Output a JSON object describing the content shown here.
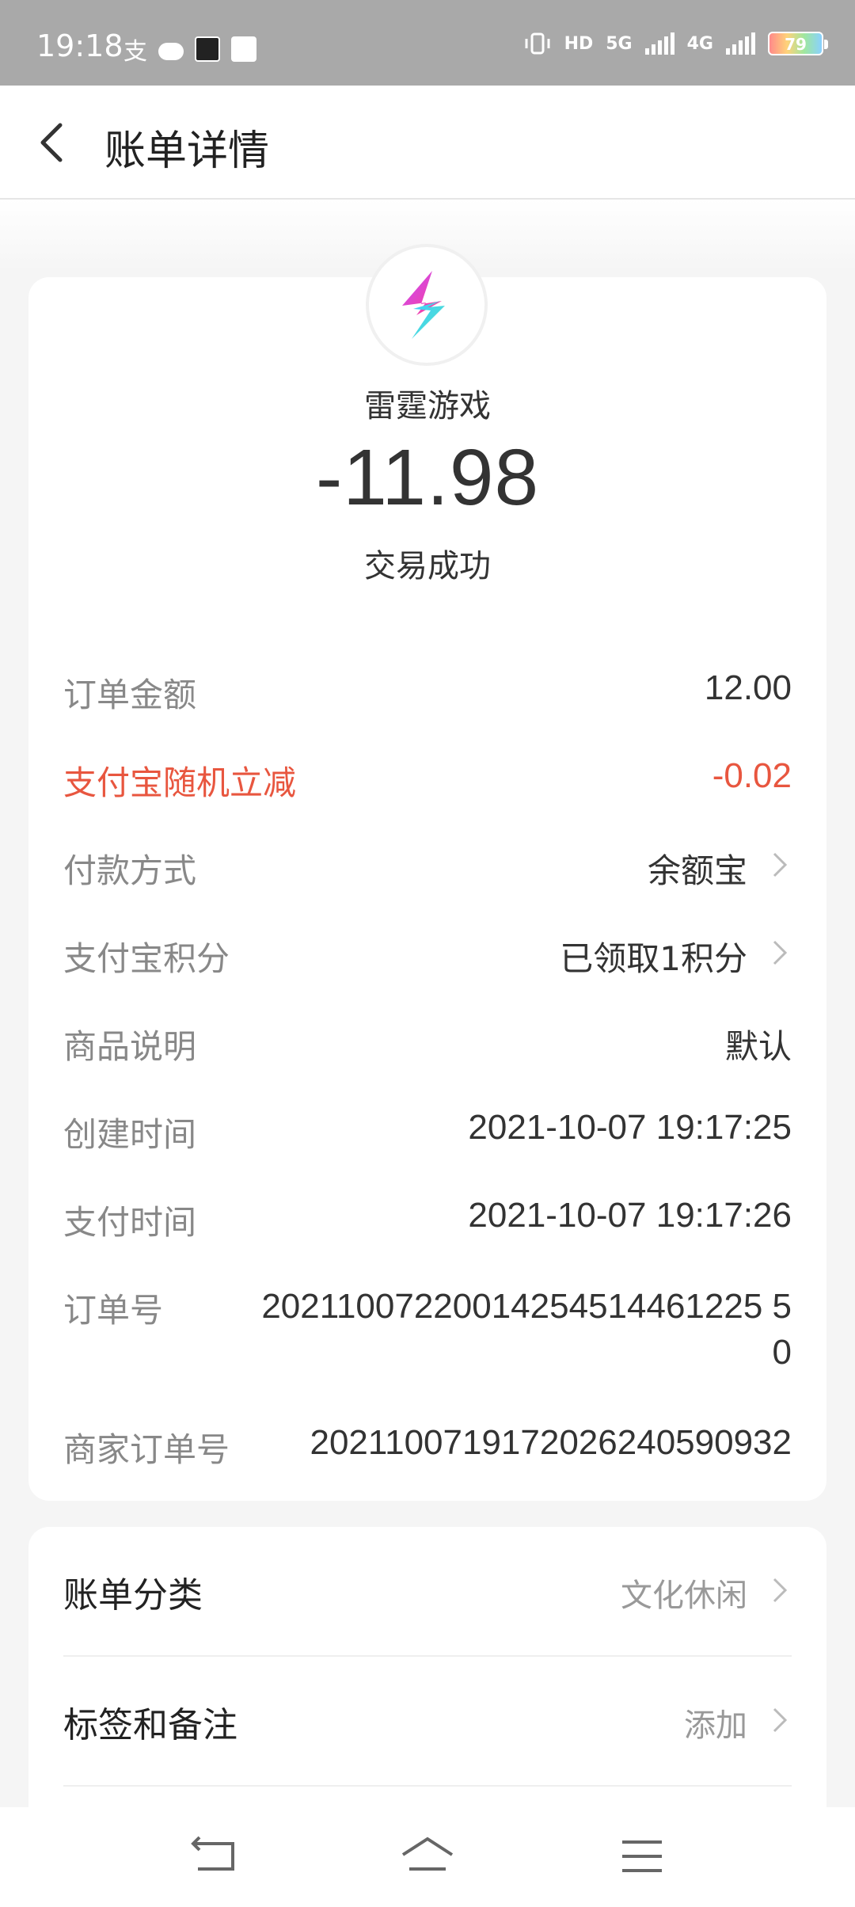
{
  "status_bar": {
    "time": "19:18",
    "alipay_glyph": "支",
    "hd_label": "HD",
    "net_5g": "5G",
    "net_4g": "4G",
    "battery": "79"
  },
  "header": {
    "title": "账单详情"
  },
  "transaction": {
    "merchant": "雷霆游戏",
    "amount": "-11.98",
    "status": "交易成功"
  },
  "details": [
    {
      "label": "订单金额",
      "value": "12.00"
    },
    {
      "label": "支付宝随机立减",
      "value": "-0.02"
    },
    {
      "label": "付款方式",
      "value": "余额宝"
    },
    {
      "label": "支付宝积分",
      "value": "已领取1积分"
    },
    {
      "label": "商品说明",
      "value": "默认"
    },
    {
      "label": "创建时间",
      "value": "2021-10-07 19:17:25"
    },
    {
      "label": "支付时间",
      "value": "2021-10-07 19:17:26"
    },
    {
      "label": "订单号",
      "value": "20211007220014254514461225 50"
    },
    {
      "label": "商家订单号",
      "value": "2021100719172026240590932"
    }
  ],
  "extras": [
    {
      "label": "账单分类",
      "value": "文化休闲"
    },
    {
      "label": "标签和备注",
      "value": "添加"
    }
  ],
  "colors": {
    "accent_red": "#e8563f",
    "label_gray": "#888888",
    "background": "#f5f5f5"
  }
}
